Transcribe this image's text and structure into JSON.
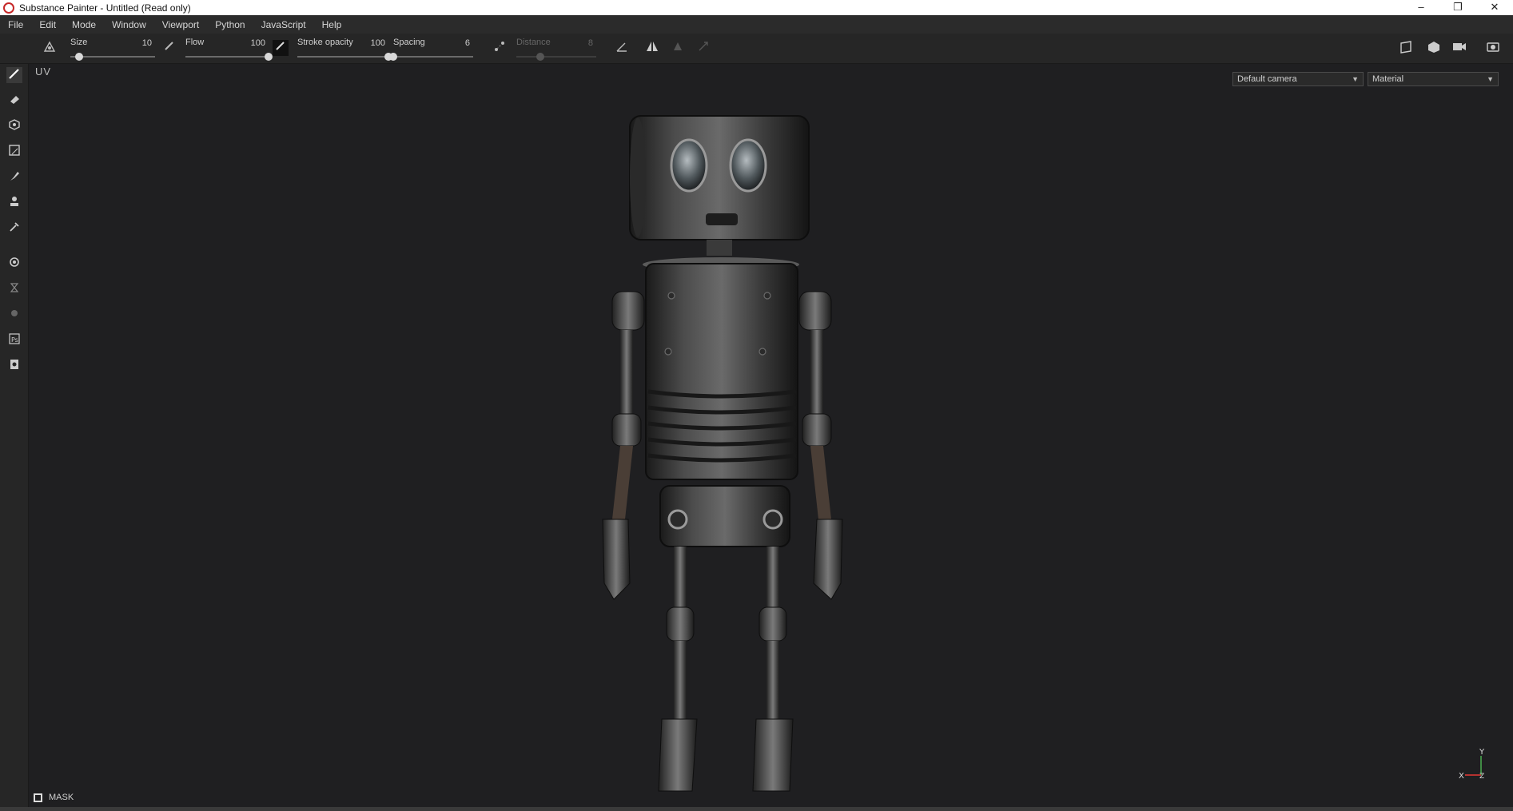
{
  "window": {
    "title": "Substance Painter - Untitled (Read only)",
    "minimize": "–",
    "restore": "❐",
    "close": "✕"
  },
  "menu": [
    "File",
    "Edit",
    "Mode",
    "Window",
    "Viewport",
    "Python",
    "JavaScript",
    "Help"
  ],
  "toolbar": {
    "size": {
      "label": "Size",
      "value": "10",
      "fraction": 0.1
    },
    "flow": {
      "label": "Flow",
      "value": "100",
      "fraction": 1.0
    },
    "stroke_opacity": {
      "label": "Stroke opacity",
      "value": "100",
      "fraction": 1.0
    },
    "spacing": {
      "label": "Spacing",
      "value": "6",
      "fraction": 0.0
    },
    "distance": {
      "label": "Distance",
      "value": "8",
      "fraction": 0.3
    }
  },
  "viewport": {
    "uv_label": "UV",
    "camera_select": "Default camera",
    "channel_select": "Material",
    "mask_label": "MASK",
    "axis_x": "X",
    "axis_y": "Y",
    "axis_z": "Z"
  },
  "colors": {
    "accent": "#c62828",
    "background": "#1f1f21",
    "panel": "#262626"
  }
}
